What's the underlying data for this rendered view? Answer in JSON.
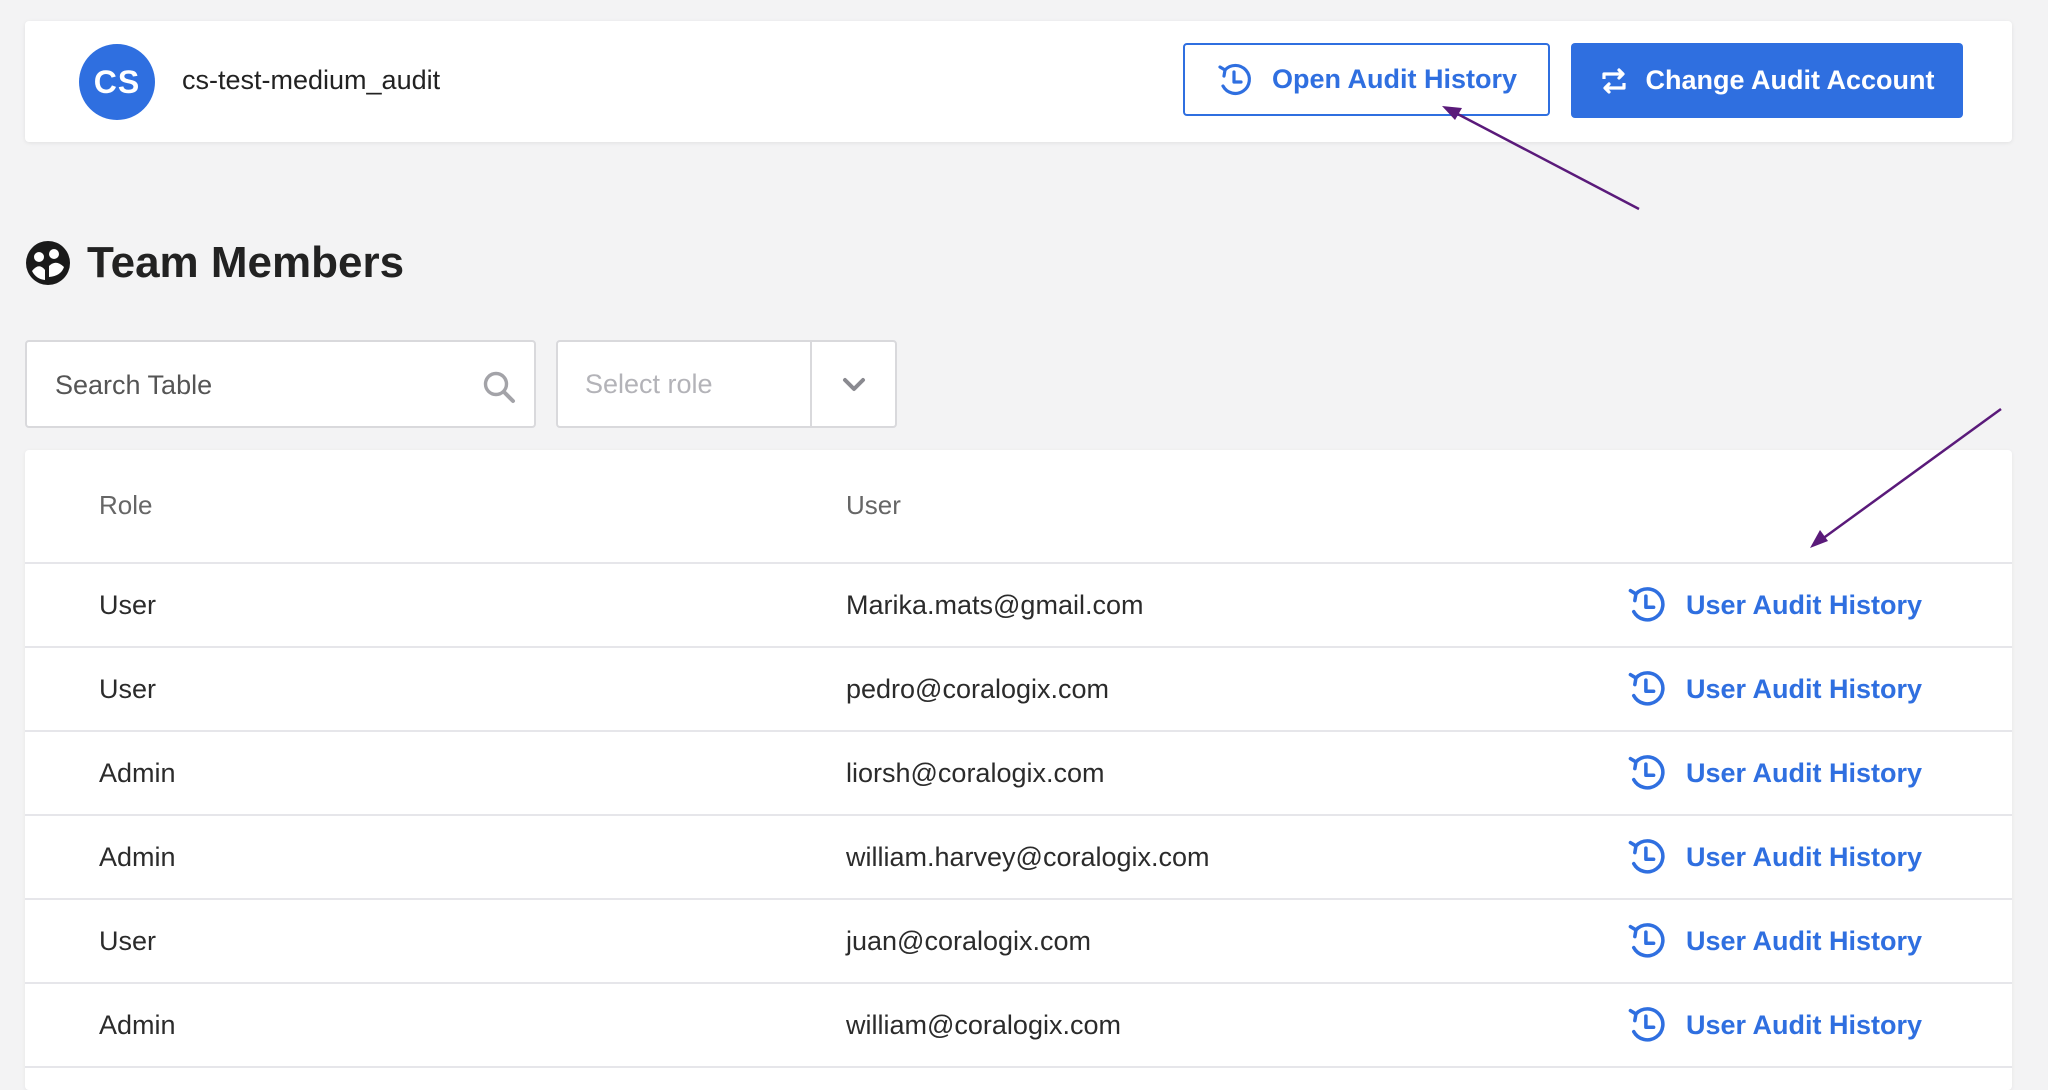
{
  "account": {
    "avatar_initials": "CS",
    "name": "cs-test-medium_audit",
    "open_audit_label": "Open Audit History",
    "change_account_label": "Change Audit Account"
  },
  "section": {
    "title": "Team Members"
  },
  "filters": {
    "search_placeholder": "Search Table",
    "role_placeholder": "Select role"
  },
  "table": {
    "columns": [
      "Role",
      "User"
    ],
    "rows": [
      {
        "role": "User",
        "user": "Marika.mats@gmail.com",
        "action": "User Audit History"
      },
      {
        "role": "User",
        "user": "pedro@coralogix.com",
        "action": "User Audit History"
      },
      {
        "role": "Admin",
        "user": "liorsh@coralogix.com",
        "action": "User Audit History"
      },
      {
        "role": "Admin",
        "user": "william.harvey@coralogix.com",
        "action": "User Audit History"
      },
      {
        "role": "User",
        "user": "juan@coralogix.com",
        "action": "User Audit History"
      },
      {
        "role": "Admin",
        "user": "william@coralogix.com",
        "action": "User Audit History"
      }
    ]
  },
  "colors": {
    "accent": "#2f6fe0",
    "annotation_arrow": "#5a1a7a",
    "background": "#f3f3f4"
  }
}
